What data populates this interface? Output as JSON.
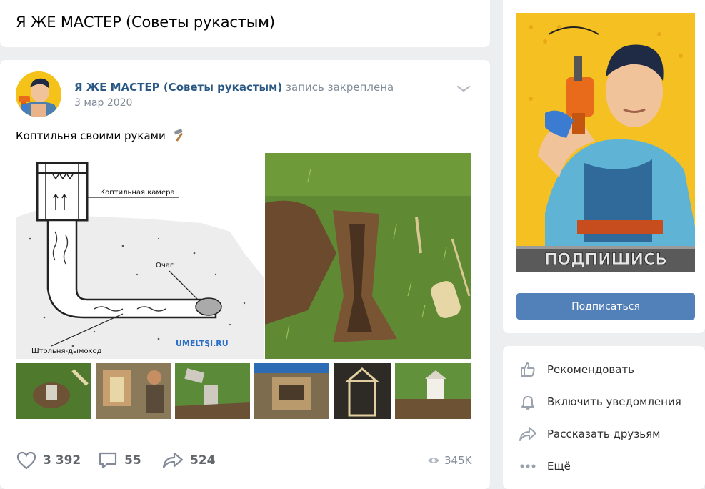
{
  "header": {
    "title": "Я ЖЕ МАСТЕР (Советы рукастым)"
  },
  "post": {
    "author": "Я ЖЕ МАСТЕР (Советы рукастым)",
    "pinned_note": "запись закреплена",
    "date": "3 мар 2020",
    "text": "Коптильня своими руками",
    "diagram": {
      "label_chamber": "Коптильная камера",
      "label_hearth": "Очаг",
      "label_flue": "Штольня-дымоход",
      "watermark": "UMELTSI.RU"
    },
    "likes": "3 392",
    "comments": "55",
    "shares": "524",
    "views": "345K"
  },
  "sidebar": {
    "promo_label": "ПОДПИШИСЬ",
    "subscribe_label": "Подписаться",
    "actions": [
      {
        "label": "Рекомендовать",
        "icon": "thumbs-up-icon"
      },
      {
        "label": "Включить уведомления",
        "icon": "bell-icon"
      },
      {
        "label": "Рассказать друзьям",
        "icon": "share-arrow-icon"
      },
      {
        "label": "Ещё",
        "icon": "more-dots-icon"
      }
    ]
  },
  "colors": {
    "link": "#2a5885",
    "button": "#5181b8",
    "muted": "#818c99",
    "background": "#edeef0"
  }
}
